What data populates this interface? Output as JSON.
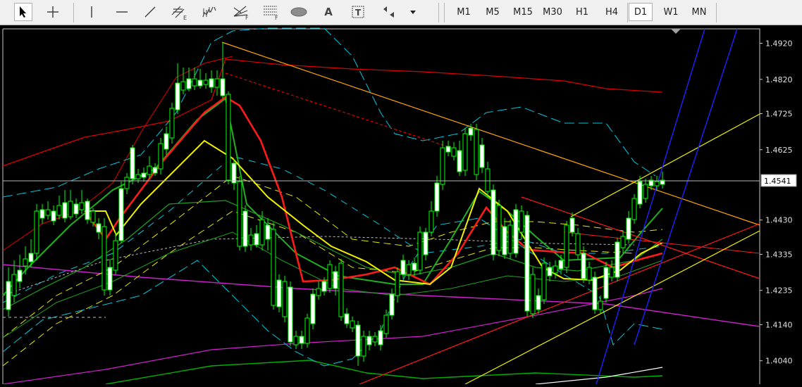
{
  "toolbar": {
    "tools": [
      "cursor-icon",
      "crosshair-icon",
      "vertical-line-icon",
      "horizontal-line-icon",
      "trendline-icon",
      "equidistant-channel-icon",
      "std-deviation-channel-icon",
      "fibonacci-fan-icon",
      "fibonacci-retracement-icon",
      "ellipse-icon",
      "text-icon",
      "text-label-icon",
      "arrows-icon",
      "dropdown-arrow-icon"
    ],
    "text_tool_label": "A",
    "label_tool_label": "T",
    "fib_e_sub": "E",
    "fib_f_sub": "F",
    "timeframes": [
      "M1",
      "M5",
      "M15",
      "M30",
      "H1",
      "H4",
      "D1",
      "W1",
      "MN"
    ],
    "active_timeframe": "D1"
  },
  "chart_data": {
    "type": "candlestick",
    "y_axis_labels": [
      "1.4920",
      "1.4820",
      "1.4725",
      "1.4625",
      "1.4430",
      "1.4335",
      "1.4235",
      "1.4140",
      "1.4040"
    ],
    "current_price": "1.4541",
    "ylim": [
      1.3975,
      1.496
    ],
    "grid": false,
    "background": "#000000",
    "colors": {
      "bull_body": "#ffffff",
      "bear_body": "#000000",
      "candle_border": "#00ff00",
      "price_line": "#c0c0c0"
    }
  }
}
